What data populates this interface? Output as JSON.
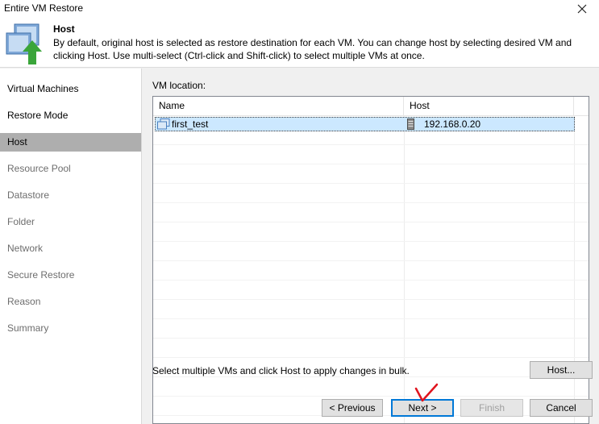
{
  "window": {
    "title": "Entire VM Restore"
  },
  "header": {
    "title": "Host",
    "description": "By default, original host is selected as restore destination for each VM. You can change host by selecting desired VM and clicking Host. Use multi-select (Ctrl-click and Shift-click) to select multiple VMs at once.",
    "icon": "restore-server-icon"
  },
  "steps": [
    {
      "label": "Virtual Machines",
      "state": "done"
    },
    {
      "label": "Restore Mode",
      "state": "done"
    },
    {
      "label": "Host",
      "state": "active"
    },
    {
      "label": "Resource Pool",
      "state": "pending"
    },
    {
      "label": "Datastore",
      "state": "pending"
    },
    {
      "label": "Folder",
      "state": "pending"
    },
    {
      "label": "Network",
      "state": "pending"
    },
    {
      "label": "Secure Restore",
      "state": "pending"
    },
    {
      "label": "Reason",
      "state": "pending"
    },
    {
      "label": "Summary",
      "state": "pending"
    }
  ],
  "vm_location": {
    "label": "VM location:",
    "columns": [
      "Name",
      "Host"
    ],
    "rows": [
      {
        "name": "first_test",
        "host": "192.168.0.20",
        "selected": true,
        "name_icon": "vm-icon",
        "host_icon": "host-server-icon"
      }
    ]
  },
  "bulk_note": "Select multiple VMs and click Host to apply changes in bulk.",
  "buttons": {
    "host": "Host...",
    "previous": "< Previous",
    "next": "Next >",
    "finish": "Finish",
    "cancel": "Cancel"
  },
  "colors": {
    "selection": "#cce8ff",
    "active_step": "#aeaeae",
    "focus_blue": "#0078d7",
    "annotation_red": "#e0141e",
    "icon_green": "#3aa53a"
  }
}
